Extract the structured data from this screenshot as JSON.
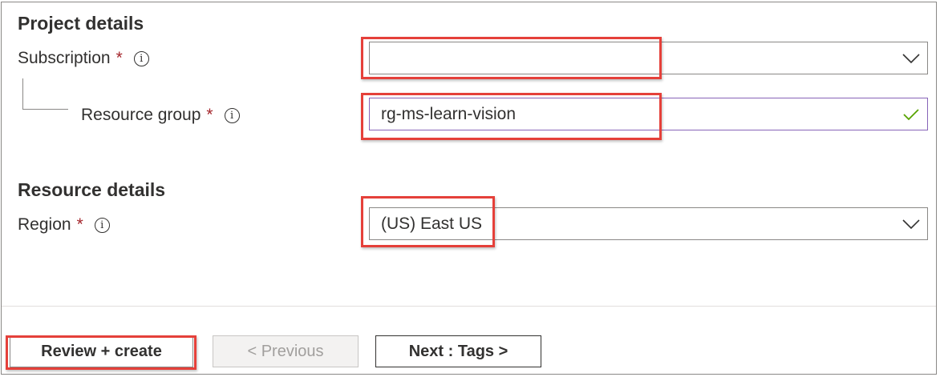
{
  "project_details": {
    "title": "Project details",
    "subscription": {
      "label": "Subscription",
      "required_mark": "*",
      "value": ""
    },
    "resource_group": {
      "label": "Resource group",
      "required_mark": "*",
      "value": "rg-ms-learn-vision"
    }
  },
  "resource_details": {
    "title": "Resource details",
    "region": {
      "label": "Region",
      "required_mark": "*",
      "value": "(US) East US"
    }
  },
  "buttons": {
    "review_create": "Review + create",
    "previous": "< Previous",
    "next": "Next : Tags >"
  },
  "icons": {
    "info": "info-icon",
    "dropdown": "chevron-down-icon",
    "valid": "checkmark-icon"
  },
  "colors": {
    "highlight": "#e5403a",
    "required": "#a4262c",
    "valid_check": "#57a300",
    "valid_border": "#8764b8"
  }
}
